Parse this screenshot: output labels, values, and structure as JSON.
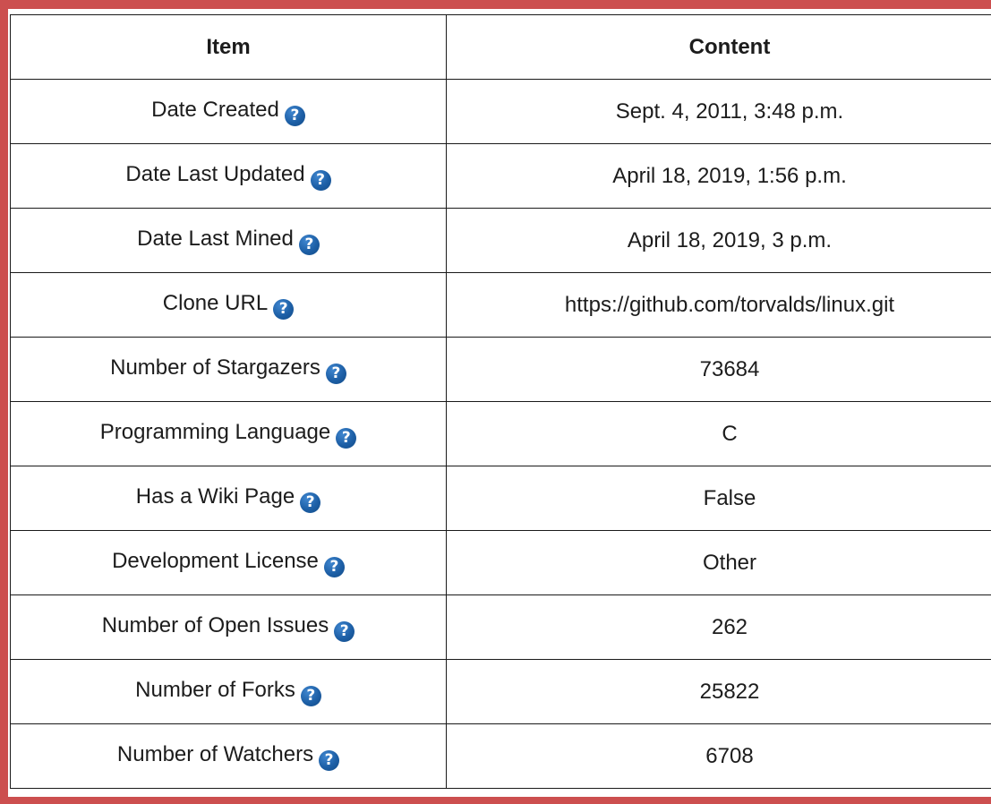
{
  "table": {
    "headers": [
      "Item",
      "Content"
    ],
    "help_glyph": "?",
    "help_icon_color": "#1d5fa6",
    "border_accent": "#cc4f4f",
    "rows": [
      {
        "item": "Date Created",
        "content": "Sept. 4, 2011, 3:48 p.m."
      },
      {
        "item": "Date Last Updated",
        "content": "April 18, 2019, 1:56 p.m."
      },
      {
        "item": "Date Last Mined",
        "content": "April 18, 2019, 3 p.m."
      },
      {
        "item": "Clone URL",
        "content": "https://github.com/torvalds/linux.git"
      },
      {
        "item": "Number of Stargazers",
        "content": "73684"
      },
      {
        "item": "Programming Language",
        "content": "C"
      },
      {
        "item": "Has a Wiki Page",
        "content": "False"
      },
      {
        "item": "Development License",
        "content": "Other"
      },
      {
        "item": "Number of Open Issues",
        "content": "262"
      },
      {
        "item": "Number of Forks",
        "content": "25822"
      },
      {
        "item": "Number of Watchers",
        "content": "6708"
      }
    ]
  }
}
